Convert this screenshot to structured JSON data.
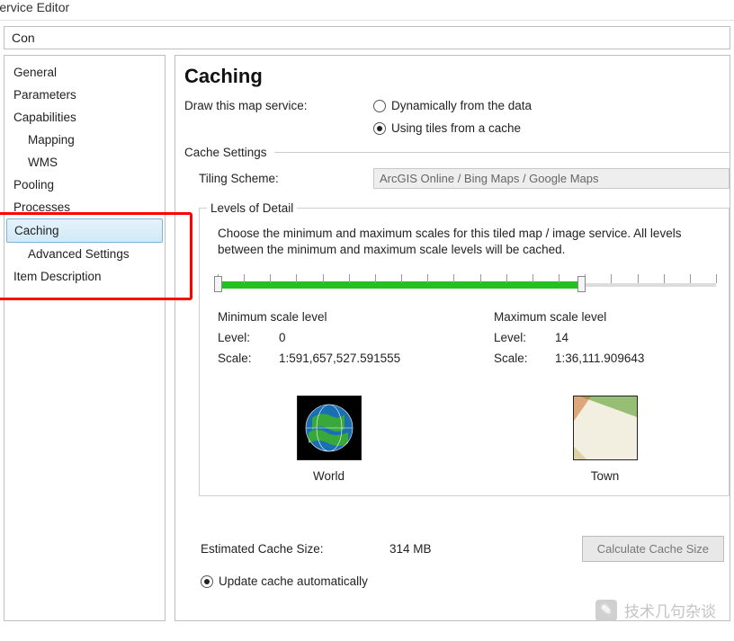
{
  "window": {
    "title": "Service Editor"
  },
  "topbar": {
    "text": "Con"
  },
  "sidebar": {
    "items": [
      {
        "label": "General",
        "indent": false
      },
      {
        "label": "Parameters",
        "indent": false
      },
      {
        "label": "Capabilities",
        "indent": false
      },
      {
        "label": "Mapping",
        "indent": true
      },
      {
        "label": "WMS",
        "indent": true
      },
      {
        "label": "Pooling",
        "indent": false
      },
      {
        "label": "Processes",
        "indent": false
      },
      {
        "label": "Caching",
        "indent": false,
        "selected": true
      },
      {
        "label": "Advanced Settings",
        "indent": true
      },
      {
        "label": "Item Description",
        "indent": false
      }
    ]
  },
  "page": {
    "title": "Caching",
    "draw_label": "Draw this map service:",
    "radio_dynamic": "Dynamically from the data",
    "radio_tiles": "Using tiles from a cache",
    "cache_settings": "Cache Settings",
    "tiling_label": "Tiling Scheme:",
    "tiling_value": "ArcGIS Online / Bing Maps / Google Maps",
    "lod": {
      "legend": "Levels of Detail",
      "desc": "Choose the minimum and maximum scales for this tiled map / image service. All levels between the minimum and maximum scale levels will be cached.",
      "min_header": "Minimum scale level",
      "max_header": "Maximum scale level",
      "level_label": "Level:",
      "scale_label": "Scale:",
      "min_level": "0",
      "min_scale": "1:591,657,527.591555",
      "max_level": "14",
      "max_scale": "1:36,111.909643",
      "world_caption": "World",
      "town_caption": "Town"
    },
    "est_label": "Estimated Cache Size:",
    "est_value": "314 MB",
    "calc_button": "Calculate Cache Size",
    "update_label": "Update cache automatically"
  },
  "watermark": {
    "text": "技术几句杂谈"
  }
}
